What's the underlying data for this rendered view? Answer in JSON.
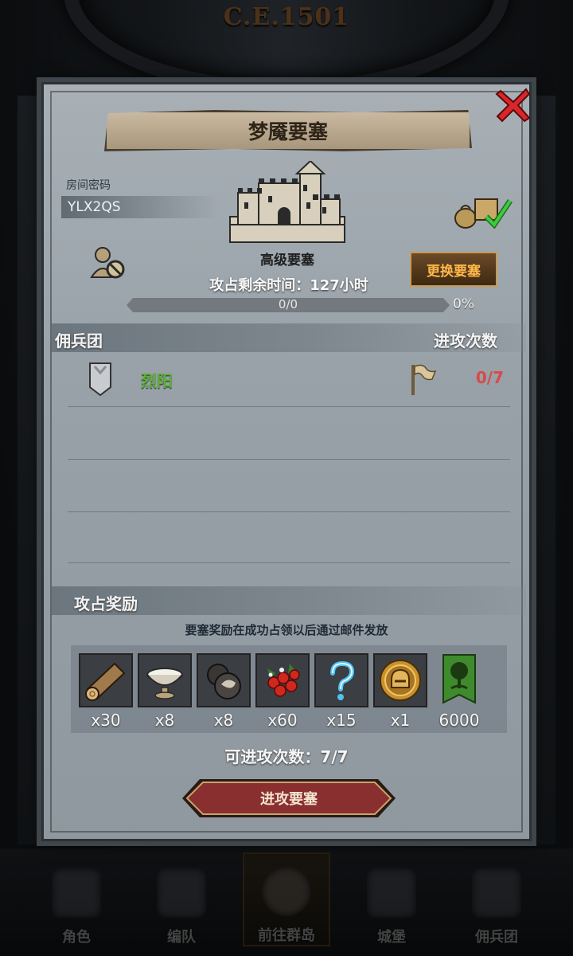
{
  "background": {
    "era": "C.E.1501"
  },
  "dialog": {
    "title": "梦魇要塞",
    "close_icon": "close-x-icon",
    "room_code_label": "房间密码",
    "room_code": "YLX2QS",
    "fortress_level": "高级要塞",
    "time_label": "攻占剩余时间：",
    "time_value": "127",
    "time_unit": "小时",
    "switch_button": "更换要塞",
    "progress": {
      "text": "0/0",
      "percent_text": "0%",
      "fraction": 0
    },
    "guild_header": "佣兵团",
    "attack_header": "进攻次数",
    "guild": {
      "name": "烈阳",
      "attacks": "0/7"
    },
    "reward_header": "攻占奖励",
    "reward_note": "要塞奖励在成功占领以后通过邮件发放",
    "rewards": [
      {
        "icon": "wood-log-icon",
        "qty": "x30"
      },
      {
        "icon": "porcelain-bowl-icon",
        "qty": "x8"
      },
      {
        "icon": "truffle-icon",
        "qty": "x8"
      },
      {
        "icon": "berries-icon",
        "qty": "x60"
      },
      {
        "icon": "mystery-question-icon",
        "qty": "x15"
      },
      {
        "icon": "helmet-coin-icon",
        "qty": "x1"
      },
      {
        "icon": "guild-tree-banner-icon",
        "qty": "6000"
      }
    ],
    "attempts_label": "可进攻次数：",
    "attempts_value": "7/7",
    "attack_button": "进攻要塞"
  },
  "bottom_nav": [
    {
      "label": "角色",
      "icon": "knight-icon"
    },
    {
      "label": "编队",
      "icon": "formation-icon"
    },
    {
      "label": "前往群岛",
      "icon": "compass-icon",
      "active": true
    },
    {
      "label": "城堡",
      "icon": "castle-icon"
    },
    {
      "label": "佣兵团",
      "icon": "mercenary-tower-icon"
    }
  ],
  "colors": {
    "guild_name": "#5fb13a",
    "attack_count": "#d84a4a",
    "switch_text": "#ffb84a",
    "attack_button": "#8a2f2f"
  }
}
